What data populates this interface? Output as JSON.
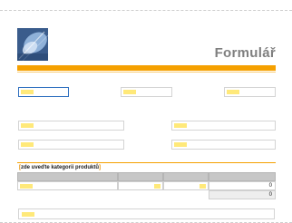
{
  "document": {
    "title": "Formulář",
    "section_label": "[zde uveďte kategorii produktů]"
  },
  "table": {
    "rows": [
      {
        "amount": "0"
      },
      {
        "amount": "0"
      }
    ]
  },
  "colors": {
    "accent": "#f5a000",
    "title_text": "#7f7f7f",
    "field_highlight": "#ffe97a",
    "table_header": "#c7c7c7",
    "focus_border": "#2e6fbf"
  }
}
